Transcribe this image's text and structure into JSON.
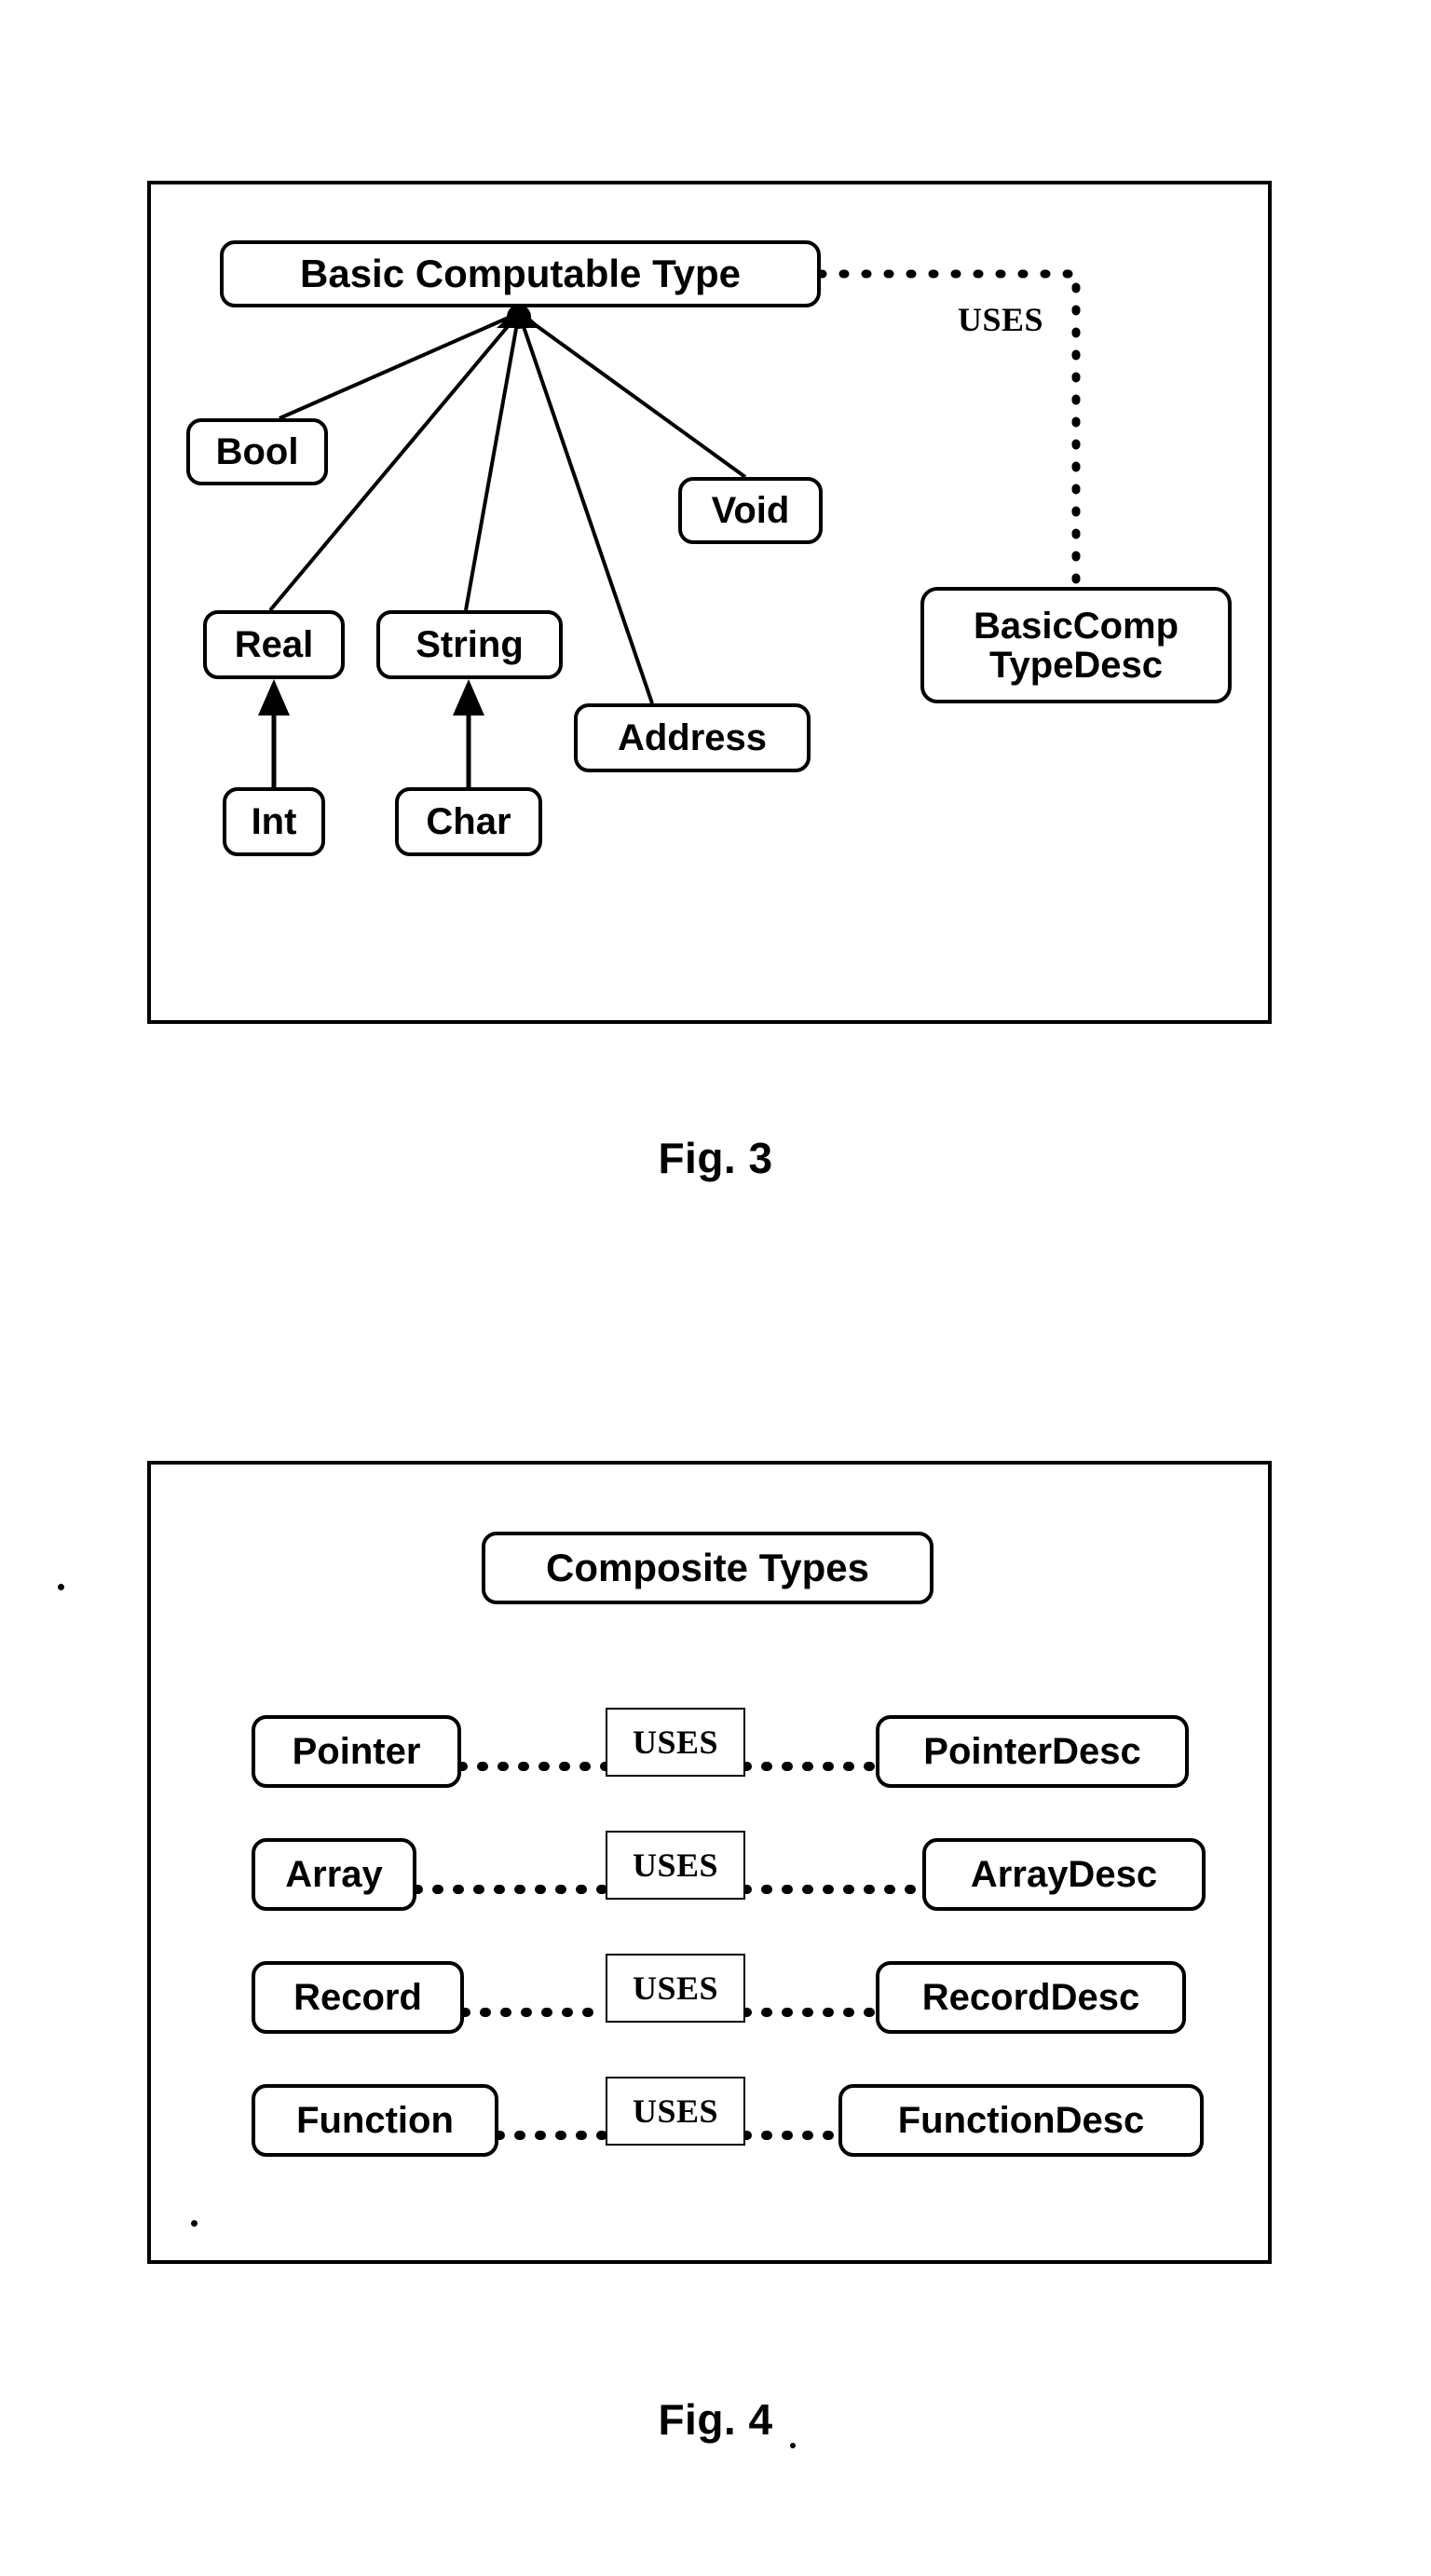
{
  "figures": [
    {
      "caption": "Fig. 3",
      "title_node": "Basic Computable Type",
      "nodes": {
        "basic": "Basic Computable Type",
        "bool": "Bool",
        "void": "Void",
        "real": "Real",
        "string": "String",
        "address": "Address",
        "int": "Int",
        "char": "Char",
        "basiccomptypedesc": "BasicComp\nTypeDesc"
      },
      "relation_label": "USES",
      "generalizations": [
        {
          "parent": "Basic Computable Type",
          "children": [
            "Bool",
            "Real",
            "String",
            "Address",
            "Void"
          ]
        },
        {
          "parent": "Real",
          "children": [
            "Int"
          ]
        },
        {
          "parent": "String",
          "children": [
            "Char"
          ]
        }
      ],
      "uses_relations": [
        {
          "from": "Basic Computable Type",
          "to": "BasicComp TypeDesc",
          "label": "USES"
        }
      ]
    },
    {
      "caption": "Fig. 4",
      "title_node": "Composite Types",
      "nodes": {
        "composite": "Composite Types",
        "pointer": "Pointer",
        "array": "Array",
        "record": "Record",
        "function": "Function",
        "pointerdesc": "PointerDesc",
        "arraydesc": "ArrayDesc",
        "recorddesc": "RecordDesc",
        "functiondesc": "FunctionDesc"
      },
      "relation_label": "USES",
      "uses_relations": [
        {
          "from": "Pointer",
          "label": "USES",
          "to": "PointerDesc"
        },
        {
          "from": "Array",
          "label": "USES",
          "to": "ArrayDesc"
        },
        {
          "from": "Record",
          "label": "USES",
          "to": "RecordDesc"
        },
        {
          "from": "Function",
          "label": "USES",
          "to": "FunctionDesc"
        }
      ]
    }
  ],
  "colors": {
    "ink": "#000000",
    "paper": "#ffffff"
  }
}
